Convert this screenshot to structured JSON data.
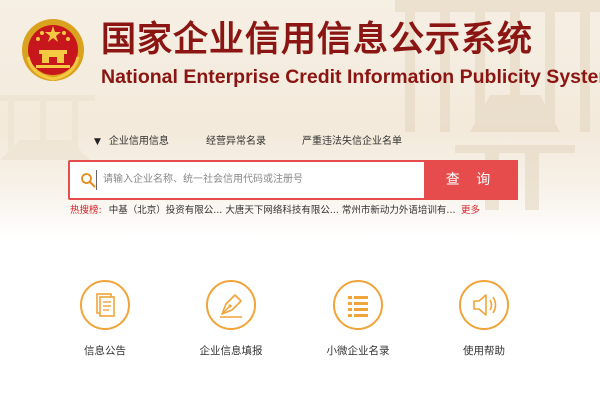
{
  "header": {
    "title_cn": "国家企业信用信息公示系统",
    "title_en": "National Enterprise Credit Information Publicity System"
  },
  "tabs": [
    {
      "label": "企业信用信息",
      "selected": true
    },
    {
      "label": "经营异常名录",
      "selected": false
    },
    {
      "label": "严重违法失信企业名单",
      "selected": false
    }
  ],
  "search": {
    "placeholder": "请输入企业名称、统一社会信用代码或注册号",
    "value": "",
    "button_label": "查  询"
  },
  "hot_search": {
    "label": "热搜榜:",
    "items": [
      "中基（北京）投资有限公...",
      "大唐天下网络科技有限公...",
      "常州市新动力外语培训有..."
    ],
    "more_label": "更多"
  },
  "features": [
    {
      "label": "信息公告",
      "icon": "document-icon"
    },
    {
      "label": "企业信息填报",
      "icon": "pen-nib-icon"
    },
    {
      "label": "小微企业名录",
      "icon": "list-icon"
    },
    {
      "label": "使用帮助",
      "icon": "speaker-icon"
    }
  ],
  "colors": {
    "brand_red": "#8a1512",
    "search_red": "#e64c4c",
    "hot_red": "#d8232a",
    "feature_orange": "#f0a43a",
    "hero_bg": "#f4ecdf"
  }
}
